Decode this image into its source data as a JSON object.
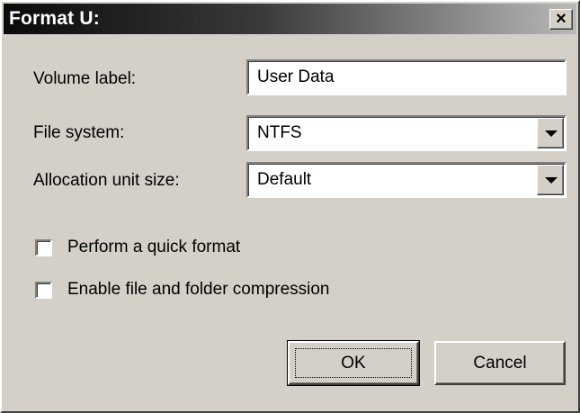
{
  "window": {
    "title": "Format U:",
    "close_label": "×"
  },
  "form": {
    "volume_label": {
      "label": "Volume label:",
      "value": "User Data"
    },
    "file_system": {
      "label": "File system:",
      "value": "NTFS"
    },
    "allocation_unit_size": {
      "label": "Allocation unit size:",
      "value": "Default"
    }
  },
  "options": {
    "quick_format": {
      "label": "Perform a quick format",
      "checked": false
    },
    "compression": {
      "label": "Enable file and folder compression",
      "checked": false
    }
  },
  "buttons": {
    "ok": "OK",
    "cancel": "Cancel"
  }
}
